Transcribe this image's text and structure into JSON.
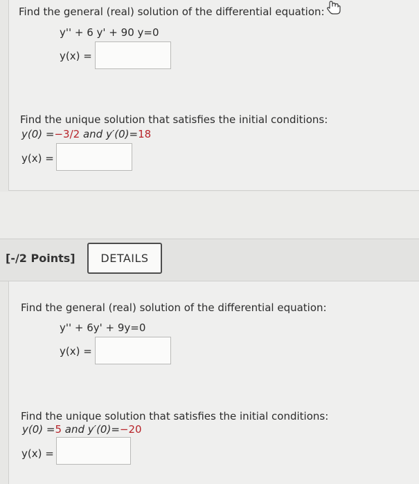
{
  "problem_1": {
    "part_a": {
      "prompt": "Find the general (real) solution of the differential equation:",
      "equation": "y'' + 6 y' + 90 y=0",
      "answer_label": "y(x) ="
    },
    "part_b": {
      "prompt": "Find the unique solution that satisfies the initial conditions:",
      "cond_prefix": "y(0) =",
      "cond_value_1": "−3/2",
      "cond_middle": "and y′(0)=",
      "cond_value_2": "18",
      "answer_label": "y(x) ="
    }
  },
  "problem_2": {
    "header": {
      "points": "[-/2 Points]",
      "details_label": "DETAILS"
    },
    "part_a": {
      "prompt": "Find the general (real) solution of the differential equation:",
      "equation": "y'' + 6y' + 9y=0",
      "answer_label": "y(x) ="
    },
    "part_b": {
      "prompt": "Find the unique solution that satisfies the initial conditions:",
      "cond_prefix": "y(0) =",
      "cond_value_1": "5",
      "cond_middle": "and y′(0)=",
      "cond_value_2": "−20",
      "answer_label": "y(x) ="
    }
  },
  "icons": {
    "cursor": "hand-pointer-icon"
  },
  "colors": {
    "page_bg": "#e7e7e5",
    "panel_bg": "#efefee",
    "text": "#2c2c2c",
    "highlight_red": "#b7242a",
    "input_bg": "#fbfbfa"
  }
}
